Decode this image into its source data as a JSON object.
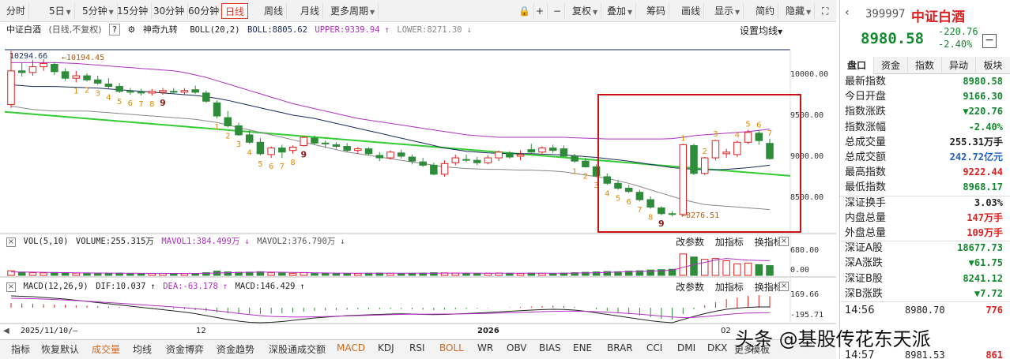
{
  "toolbar": {
    "items": [
      "分时",
      "5日",
      "5分钟",
      "15分钟",
      "30分钟",
      "60分钟",
      "日线",
      "周线",
      "月线",
      "更多周期"
    ],
    "active": "日线",
    "right_items": [
      "复权",
      "叠加",
      "筹码",
      "画线",
      "显示",
      "简约",
      "隐藏"
    ]
  },
  "main_header": {
    "name": "中证白酒",
    "mode": "(日线,不复权)",
    "help": "?",
    "indicator": "神奇九转",
    "boll_label": "BOLL(20,2)",
    "boll_val": "BOLL:8805.62",
    "upper_val": "UPPER:9339.94",
    "lower_val": "LOWER:8271.30",
    "ma_settings": "设置均线"
  },
  "price_axis": [
    "10000.00",
    "9500.00",
    "9000.00",
    "8500.00"
  ],
  "annotations": {
    "high_left": "10294.66",
    "high_arrow": "←10194.45",
    "low_arrow": "←8276.51"
  },
  "vol_header": {
    "label": "VOL(5,10)",
    "volume": "VOLUME:255.315万",
    "mavol1": "MAVOL1:384.499万",
    "mavol2": "MAVOL2:376.790万"
  },
  "vol_axis": [
    "680.00",
    "0.00"
  ],
  "macd_header": {
    "label": "MACD(12,26,9)",
    "dif": "DIF:10.037",
    "dea": "DEA:-63.178",
    "macd": "MACD:146.429"
  },
  "macd_axis": [
    "169.66",
    "-195.71"
  ],
  "sub_buttons": [
    "改参数",
    "加指标",
    "换指标"
  ],
  "close_icon": "×",
  "x_axis": {
    "start": "2025/11/10/—",
    "mid1": "12",
    "year": "2026",
    "end": "02"
  },
  "bottom_tabs": [
    "指标",
    "恢复默认",
    "成交量",
    "均线",
    "资金博弈",
    "资金趋势",
    "深股通成交额",
    "MACD",
    "KDJ",
    "RSI",
    "BOLL",
    "WR",
    "OBV",
    "BIAS",
    "ENE",
    "BRAR",
    "CCI",
    "DMI",
    "DKX",
    "更多",
    "模板"
  ],
  "accent_tabs": [
    "成交量",
    "MACD",
    "BOLL"
  ],
  "panel": {
    "code": "399997",
    "name": "中证白酒",
    "price": "8980.58",
    "change": "-220.76",
    "change_pct": "-2.40%",
    "collapse_icon": "−",
    "tabs": [
      "盘口",
      "资金",
      "指数",
      "异动",
      "板块"
    ],
    "rows": [
      {
        "k": "最新指数",
        "v": "8980.58",
        "c": "green"
      },
      {
        "k": "今日开盘",
        "v": "9166.30",
        "c": "green"
      },
      {
        "k": "指数涨跌",
        "v": "▼220.76",
        "c": "green"
      },
      {
        "k": "指数涨幅",
        "v": "-2.40%",
        "c": "green"
      },
      {
        "k": "总成交量",
        "v": "255.31万手",
        "c": "black"
      },
      {
        "k": "总成交额",
        "v": "242.72亿元",
        "c": "blue"
      },
      {
        "k": "最高指数",
        "v": "9222.44",
        "c": "red"
      },
      {
        "k": "最低指数",
        "v": "8968.17",
        "c": "green"
      },
      {
        "k": "深证换手",
        "v": "3.03%",
        "c": "black"
      },
      {
        "k": "内盘总量",
        "v": "147万手",
        "c": "red"
      },
      {
        "k": "外盘总量",
        "v": "109万手",
        "c": "red"
      },
      {
        "k": "深证A股",
        "v": "18677.73",
        "c": "green"
      },
      {
        "k": "深A涨跌",
        "v": "▼61.75",
        "c": "green"
      },
      {
        "k": "深证B股",
        "v": "8241.12",
        "c": "green"
      },
      {
        "k": "深B涨跌",
        "v": "▼7.72",
        "c": "green"
      }
    ],
    "ticks": [
      {
        "t": "14:56",
        "p": "8980.70",
        "v": "776"
      },
      {
        "t": "14:57",
        "p": "8981.53",
        "v": "861"
      }
    ]
  },
  "colors": {
    "up": "#e02020",
    "down": "#2e8b3a",
    "boll_mid": "#1a2a5a",
    "boll_band": "#b030c0",
    "trend": "#33cc33",
    "highlight": "#cc1111"
  },
  "watermark": "头条 @基股传花东天派",
  "chart_data": {
    "type": "candlestick",
    "title": "中证白酒",
    "period": "日线",
    "candles": [
      {
        "o": 9640,
        "h": 10294,
        "l": 9600,
        "c": 10050
      },
      {
        "o": 10050,
        "h": 10150,
        "l": 9980,
        "c": 10030
      },
      {
        "o": 10030,
        "h": 10180,
        "l": 9990,
        "c": 10100
      },
      {
        "o": 10100,
        "h": 10194,
        "l": 10050,
        "c": 10140
      },
      {
        "o": 10130,
        "h": 10160,
        "l": 10000,
        "c": 10040
      },
      {
        "o": 10040,
        "h": 10080,
        "l": 9930,
        "c": 9960
      },
      {
        "o": 9960,
        "h": 10050,
        "l": 9910,
        "c": 9990
      },
      {
        "o": 9990,
        "h": 10020,
        "l": 9920,
        "c": 9940
      },
      {
        "o": 9940,
        "h": 9990,
        "l": 9880,
        "c": 9900
      },
      {
        "o": 9890,
        "h": 9960,
        "l": 9830,
        "c": 9860
      },
      {
        "o": 9860,
        "h": 9900,
        "l": 9780,
        "c": 9800
      },
      {
        "o": 9800,
        "h": 9840,
        "l": 9760,
        "c": 9790
      },
      {
        "o": 9790,
        "h": 9830,
        "l": 9750,
        "c": 9780
      },
      {
        "o": 9780,
        "h": 9830,
        "l": 9750,
        "c": 9800
      },
      {
        "o": 9790,
        "h": 9840,
        "l": 9760,
        "c": 9810
      },
      {
        "o": 9800,
        "h": 9840,
        "l": 9770,
        "c": 9790
      },
      {
        "o": 9790,
        "h": 9840,
        "l": 9760,
        "c": 9810
      },
      {
        "o": 9820,
        "h": 9870,
        "l": 9770,
        "c": 9790
      },
      {
        "o": 9780,
        "h": 9810,
        "l": 9660,
        "c": 9680
      },
      {
        "o": 9660,
        "h": 9690,
        "l": 9470,
        "c": 9500
      },
      {
        "o": 9480,
        "h": 9560,
        "l": 9360,
        "c": 9380
      },
      {
        "o": 9380,
        "h": 9420,
        "l": 9260,
        "c": 9270
      },
      {
        "o": 9270,
        "h": 9330,
        "l": 9160,
        "c": 9180
      },
      {
        "o": 9180,
        "h": 9230,
        "l": 9020,
        "c": 9040
      },
      {
        "o": 9030,
        "h": 9130,
        "l": 8990,
        "c": 9110
      },
      {
        "o": 9110,
        "h": 9150,
        "l": 8990,
        "c": 9060
      },
      {
        "o": 9080,
        "h": 9140,
        "l": 9040,
        "c": 9120
      },
      {
        "o": 9140,
        "h": 9250,
        "l": 9130,
        "c": 9240
      },
      {
        "o": 9230,
        "h": 9260,
        "l": 9150,
        "c": 9170
      },
      {
        "o": 9170,
        "h": 9200,
        "l": 9110,
        "c": 9160
      },
      {
        "o": 9150,
        "h": 9180,
        "l": 9100,
        "c": 9130
      },
      {
        "o": 9130,
        "h": 9170,
        "l": 9060,
        "c": 9080
      },
      {
        "o": 9080,
        "h": 9120,
        "l": 9040,
        "c": 9100
      },
      {
        "o": 9100,
        "h": 9120,
        "l": 9020,
        "c": 9040
      },
      {
        "o": 9020,
        "h": 9060,
        "l": 8950,
        "c": 8990
      },
      {
        "o": 8990,
        "h": 9080,
        "l": 8970,
        "c": 9060
      },
      {
        "o": 9050,
        "h": 9090,
        "l": 8980,
        "c": 9010
      },
      {
        "o": 9000,
        "h": 9030,
        "l": 8910,
        "c": 8950
      },
      {
        "o": 8940,
        "h": 8990,
        "l": 8880,
        "c": 8900
      },
      {
        "o": 8900,
        "h": 8930,
        "l": 8780,
        "c": 8790
      },
      {
        "o": 8790,
        "h": 8960,
        "l": 8760,
        "c": 8920
      },
      {
        "o": 8930,
        "h": 9030,
        "l": 8900,
        "c": 8990
      },
      {
        "o": 8970,
        "h": 9030,
        "l": 8940,
        "c": 8960
      },
      {
        "o": 8960,
        "h": 9000,
        "l": 8900,
        "c": 8930
      },
      {
        "o": 8930,
        "h": 9020,
        "l": 8910,
        "c": 8990
      },
      {
        "o": 8990,
        "h": 9080,
        "l": 8950,
        "c": 9060
      },
      {
        "o": 9050,
        "h": 9070,
        "l": 8980,
        "c": 9000
      },
      {
        "o": 9010,
        "h": 9080,
        "l": 8960,
        "c": 9030
      },
      {
        "o": 9090,
        "h": 9160,
        "l": 9050,
        "c": 9060
      },
      {
        "o": 9060,
        "h": 9130,
        "l": 9030,
        "c": 9110
      },
      {
        "o": 9110,
        "h": 9150,
        "l": 9050,
        "c": 9080
      },
      {
        "o": 9100,
        "h": 9140,
        "l": 9000,
        "c": 9010
      },
      {
        "o": 9010,
        "h": 9040,
        "l": 8930,
        "c": 8950
      },
      {
        "o": 8950,
        "h": 8990,
        "l": 8870,
        "c": 8880
      },
      {
        "o": 8880,
        "h": 8910,
        "l": 8760,
        "c": 8770
      },
      {
        "o": 8760,
        "h": 8800,
        "l": 8660,
        "c": 8680
      },
      {
        "o": 8680,
        "h": 8720,
        "l": 8600,
        "c": 8620
      },
      {
        "o": 8620,
        "h": 8660,
        "l": 8560,
        "c": 8580
      },
      {
        "o": 8570,
        "h": 8600,
        "l": 8460,
        "c": 8480
      },
      {
        "o": 8480,
        "h": 8520,
        "l": 8370,
        "c": 8390
      },
      {
        "o": 8380,
        "h": 8400,
        "l": 8290,
        "c": 8310
      },
      {
        "o": 8310,
        "h": 8340,
        "l": 8276,
        "c": 8300
      },
      {
        "o": 8300,
        "h": 9160,
        "l": 8290,
        "c": 9150
      },
      {
        "o": 9140,
        "h": 9160,
        "l": 8780,
        "c": 8800
      },
      {
        "o": 8800,
        "h": 9000,
        "l": 8780,
        "c": 8990
      },
      {
        "o": 8990,
        "h": 9210,
        "l": 8960,
        "c": 9200
      },
      {
        "o": 9040,
        "h": 9100,
        "l": 8990,
        "c": 9060
      },
      {
        "o": 9030,
        "h": 9200,
        "l": 9000,
        "c": 9180
      },
      {
        "o": 9180,
        "h": 9330,
        "l": 9160,
        "c": 9300
      },
      {
        "o": 9290,
        "h": 9320,
        "l": 9150,
        "c": 9200
      },
      {
        "o": 9166,
        "h": 9222,
        "l": 8968,
        "c": 8980
      }
    ],
    "boll_mid": [
      9880,
      9870,
      9860,
      9860,
      9860,
      9855,
      9850,
      9845,
      9840,
      9830,
      9820,
      9810,
      9800,
      9790,
      9780,
      9770,
      9760,
      9750,
      9735,
      9715,
      9690,
      9660,
      9630,
      9600,
      9570,
      9540,
      9510,
      9490,
      9470,
      9440,
      9410,
      9380,
      9350,
      9320,
      9290,
      9260,
      9230,
      9200,
      9170,
      9140,
      9110,
      9090,
      9070,
      9060,
      9050,
      9045,
      9040,
      9040,
      9040,
      9035,
      9030,
      9025,
      9015,
      9005,
      8995,
      8980,
      8965,
      8950,
      8930,
      8910,
      8890,
      8870,
      8860,
      8850,
      8845,
      8845,
      8850,
      8860,
      8870,
      8885,
      8900
    ],
    "boll_upper": [
      10150,
      10150,
      10150,
      10150,
      10150,
      10145,
      10140,
      10130,
      10120,
      10110,
      10100,
      10090,
      10080,
      10070,
      10060,
      10050,
      10030,
      10000,
      9970,
      9930,
      9890,
      9850,
      9810,
      9770,
      9730,
      9690,
      9650,
      9620,
      9590,
      9560,
      9530,
      9500,
      9470,
      9450,
      9430,
      9410,
      9390,
      9370,
      9350,
      9330,
      9310,
      9290,
      9270,
      9260,
      9250,
      9240,
      9240,
      9240,
      9240,
      9240,
      9240,
      9240,
      9235,
      9230,
      9225,
      9220,
      9220,
      9220,
      9220,
      9220,
      9220,
      9225,
      9240,
      9260,
      9270,
      9280,
      9290,
      9300,
      9310,
      9325,
      9340
    ],
    "boll_lower": [
      9620,
      9600,
      9580,
      9570,
      9560,
      9560,
      9560,
      9560,
      9550,
      9540,
      9530,
      9520,
      9510,
      9500,
      9490,
      9480,
      9470,
      9460,
      9440,
      9420,
      9390,
      9360,
      9330,
      9300,
      9270,
      9240,
      9210,
      9180,
      9150,
      9120,
      9090,
      9060,
      9040,
      9020,
      9000,
      8980,
      8960,
      8940,
      8920,
      8900,
      8880,
      8870,
      8860,
      8855,
      8850,
      8850,
      8845,
      8840,
      8840,
      8835,
      8830,
      8820,
      8800,
      8780,
      8760,
      8740,
      8710,
      8680,
      8640,
      8600,
      8560,
      8520,
      8480,
      8450,
      8420,
      8410,
      8400,
      8390,
      8380,
      8370,
      8360
    ],
    "trend_line": {
      "start": 9550,
      "end": 8770
    },
    "td_labels": [
      {
        "i": 6,
        "n": "1",
        "c": "orange"
      },
      {
        "i": 7,
        "n": "2",
        "c": "orange"
      },
      {
        "i": 8,
        "n": "3",
        "c": "orange"
      },
      {
        "i": 9,
        "n": "4",
        "c": "orange"
      },
      {
        "i": 10,
        "n": "5",
        "c": "orange"
      },
      {
        "i": 11,
        "n": "6",
        "c": "orange"
      },
      {
        "i": 12,
        "n": "7",
        "c": "orange"
      },
      {
        "i": 13,
        "n": "8",
        "c": "orange"
      },
      {
        "i": 14,
        "n": "9",
        "c": "darkred"
      },
      {
        "i": 19,
        "n": "1",
        "c": "orange"
      },
      {
        "i": 20,
        "n": "2",
        "c": "orange"
      },
      {
        "i": 21,
        "n": "3",
        "c": "orange"
      },
      {
        "i": 22,
        "n": "4",
        "c": "orange"
      },
      {
        "i": 23,
        "n": "5",
        "c": "orange"
      },
      {
        "i": 24,
        "n": "6",
        "c": "orange"
      },
      {
        "i": 25,
        "n": "7",
        "c": "orange"
      },
      {
        "i": 26,
        "n": "8",
        "c": "orange"
      },
      {
        "i": 27,
        "n": "9",
        "c": "darkred"
      },
      {
        "i": 52,
        "n": "1",
        "c": "orange"
      },
      {
        "i": 53,
        "n": "2",
        "c": "orange"
      },
      {
        "i": 54,
        "n": "3",
        "c": "orange"
      },
      {
        "i": 55,
        "n": "4",
        "c": "orange"
      },
      {
        "i": 56,
        "n": "5",
        "c": "orange"
      },
      {
        "i": 57,
        "n": "6",
        "c": "orange"
      },
      {
        "i": 58,
        "n": "7",
        "c": "orange"
      },
      {
        "i": 59,
        "n": "8",
        "c": "orange"
      },
      {
        "i": 60,
        "n": "9",
        "c": "darkred"
      },
      {
        "i": 62,
        "n": "1",
        "c": "orange"
      },
      {
        "i": 64,
        "n": "2",
        "c": "orange"
      },
      {
        "i": 65,
        "n": "3",
        "c": "orange"
      },
      {
        "i": 67,
        "n": "4",
        "c": "orange"
      },
      {
        "i": 68,
        "n": "5",
        "c": "orange"
      },
      {
        "i": 69,
        "n": "6",
        "c": "orange"
      },
      {
        "i": 70,
        "n": "7",
        "c": "orange"
      }
    ],
    "volume": [
      120,
      80,
      70,
      65,
      75,
      70,
      60,
      55,
      60,
      55,
      60,
      50,
      48,
      50,
      52,
      50,
      48,
      50,
      70,
      110,
      90,
      80,
      85,
      95,
      70,
      60,
      55,
      70,
      50,
      55,
      50,
      55,
      50,
      55,
      60,
      55,
      50,
      55,
      60,
      70,
      65,
      60,
      55,
      50,
      55,
      60,
      55,
      50,
      60,
      55,
      50,
      60,
      70,
      80,
      90,
      100,
      95,
      110,
      120,
      140,
      150,
      160,
      560,
      480,
      420,
      440,
      380,
      300,
      320,
      280,
      255
    ],
    "mavol1": [
      90,
      88,
      85,
      80,
      75,
      72,
      68,
      64,
      62,
      60,
      58,
      56,
      54,
      53,
      52,
      51,
      51,
      52,
      55,
      62,
      70,
      76,
      80,
      84,
      85,
      82,
      78,
      74,
      68,
      64,
      60,
      58,
      56,
      55,
      55,
      55,
      55,
      55,
      56,
      58,
      60,
      60,
      60,
      59,
      58,
      57,
      56,
      56,
      56,
      56,
      56,
      57,
      60,
      64,
      70,
      78,
      86,
      94,
      102,
      112,
      124,
      136,
      210,
      280,
      340,
      400,
      440,
      420,
      400,
      390,
      384
    ],
    "macd": [
      60,
      55,
      50,
      45,
      40,
      35,
      30,
      25,
      20,
      15,
      10,
      5,
      0,
      -5,
      -10,
      -15,
      -20,
      -30,
      -45,
      -60,
      -70,
      -75,
      -80,
      -80,
      -75,
      -70,
      -60,
      -50,
      -40,
      -35,
      -30,
      -25,
      -20,
      -20,
      -20,
      -15,
      -15,
      -20,
      -25,
      -30,
      -25,
      -20,
      -15,
      -10,
      -5,
      0,
      5,
      10,
      15,
      20,
      25,
      20,
      10,
      0,
      -20,
      -40,
      -60,
      -80,
      -100,
      -120,
      -140,
      -150,
      -80,
      -20,
      30,
      70,
      110,
      130,
      150,
      160,
      146
    ],
    "dif": [
      150,
      145,
      140,
      130,
      120,
      110,
      95,
      80,
      65,
      50,
      35,
      20,
      5,
      -10,
      -25,
      -40,
      -55,
      -75,
      -100,
      -125,
      -150,
      -170,
      -185,
      -190,
      -185,
      -175,
      -160,
      -145,
      -130,
      -120,
      -110,
      -100,
      -95,
      -90,
      -85,
      -80,
      -78,
      -80,
      -85,
      -88,
      -85,
      -80,
      -74,
      -68,
      -60,
      -52,
      -45,
      -38,
      -30,
      -24,
      -20,
      -22,
      -30,
      -45,
      -65,
      -85,
      -105,
      -125,
      -145,
      -165,
      -180,
      -190,
      -150,
      -110,
      -75,
      -45,
      -20,
      -5,
      5,
      10,
      10
    ],
    "dea": [
      120,
      118,
      115,
      110,
      104,
      97,
      90,
      82,
      74,
      65,
      56,
      47,
      38,
      29,
      20,
      10,
      0,
      -12,
      -25,
      -40,
      -55,
      -72,
      -88,
      -100,
      -110,
      -115,
      -118,
      -118,
      -115,
      -112,
      -108,
      -104,
      -100,
      -96,
      -92,
      -88,
      -85,
      -83,
      -82,
      -81,
      -80,
      -79,
      -77,
      -75,
      -72,
      -68,
      -64,
      -60,
      -55,
      -50,
      -46,
      -44,
      -44,
      -46,
      -50,
      -56,
      -64,
      -73,
      -83,
      -94,
      -106,
      -118,
      -125,
      -122,
      -113,
      -100,
      -86,
      -74,
      -68,
      -65,
      -63
    ]
  }
}
